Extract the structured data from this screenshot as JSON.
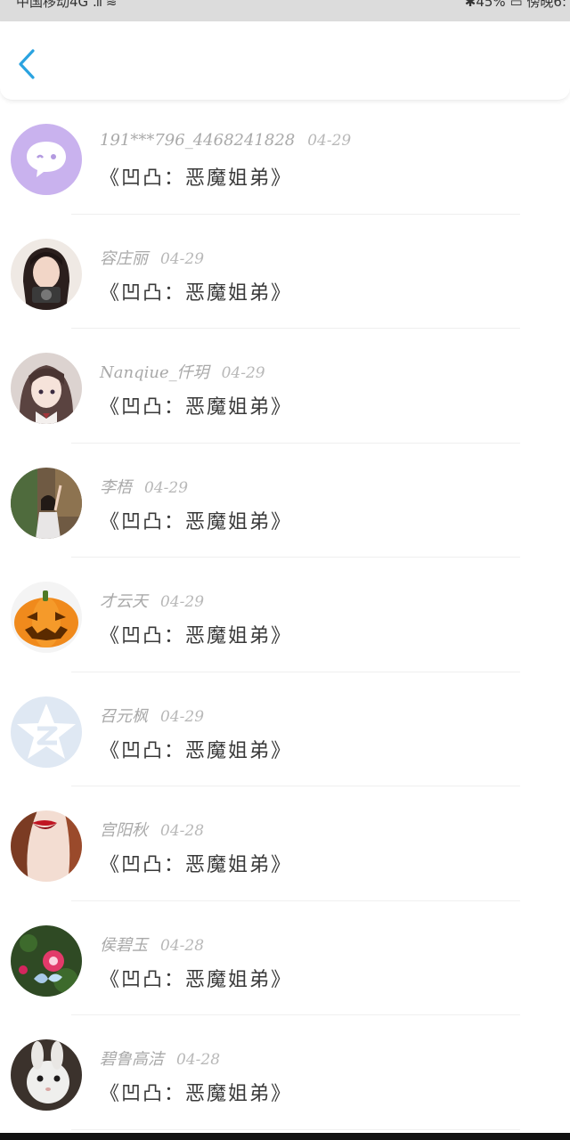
{
  "status_bar": {
    "carrier": "中国移动4G",
    "right_text": "✱45%  ▭  傍晚6:"
  },
  "nav": {
    "back_icon": "chevron-left-icon",
    "accent": "#2aa3e0"
  },
  "comments": [
    {
      "user": "191***796_4468241828",
      "date": "04-29",
      "text": "《凹凸：恶魔姐弟》",
      "avatar": "chat-bubble"
    },
    {
      "user": "容庄丽",
      "date": "04-29",
      "text": "《凹凸：恶魔姐弟》",
      "avatar": "girl-camera"
    },
    {
      "user": "Nanqiue_仟玥",
      "date": "04-29",
      "text": "《凹凸：恶魔姐弟》",
      "avatar": "anime-girl"
    },
    {
      "user": "李梧",
      "date": "04-29",
      "text": "《凹凸：恶魔姐弟》",
      "avatar": "girl-park"
    },
    {
      "user": "才云天",
      "date": "04-29",
      "text": "《凹凸：恶魔姐弟》",
      "avatar": "pumpkin"
    },
    {
      "user": "召元枫",
      "date": "04-29",
      "text": "《凹凸：恶魔姐弟》",
      "avatar": "qzone-star"
    },
    {
      "user": "宫阳秋",
      "date": "04-28",
      "text": "《凹凸：恶魔姐弟》",
      "avatar": "red-lips"
    },
    {
      "user": "侯碧玉",
      "date": "04-28",
      "text": "《凹凸：恶魔姐弟》",
      "avatar": "butterfly-flower"
    },
    {
      "user": "碧鲁高洁",
      "date": "04-28",
      "text": "《凹凸：恶魔姐弟》",
      "avatar": "white-rabbit"
    }
  ]
}
